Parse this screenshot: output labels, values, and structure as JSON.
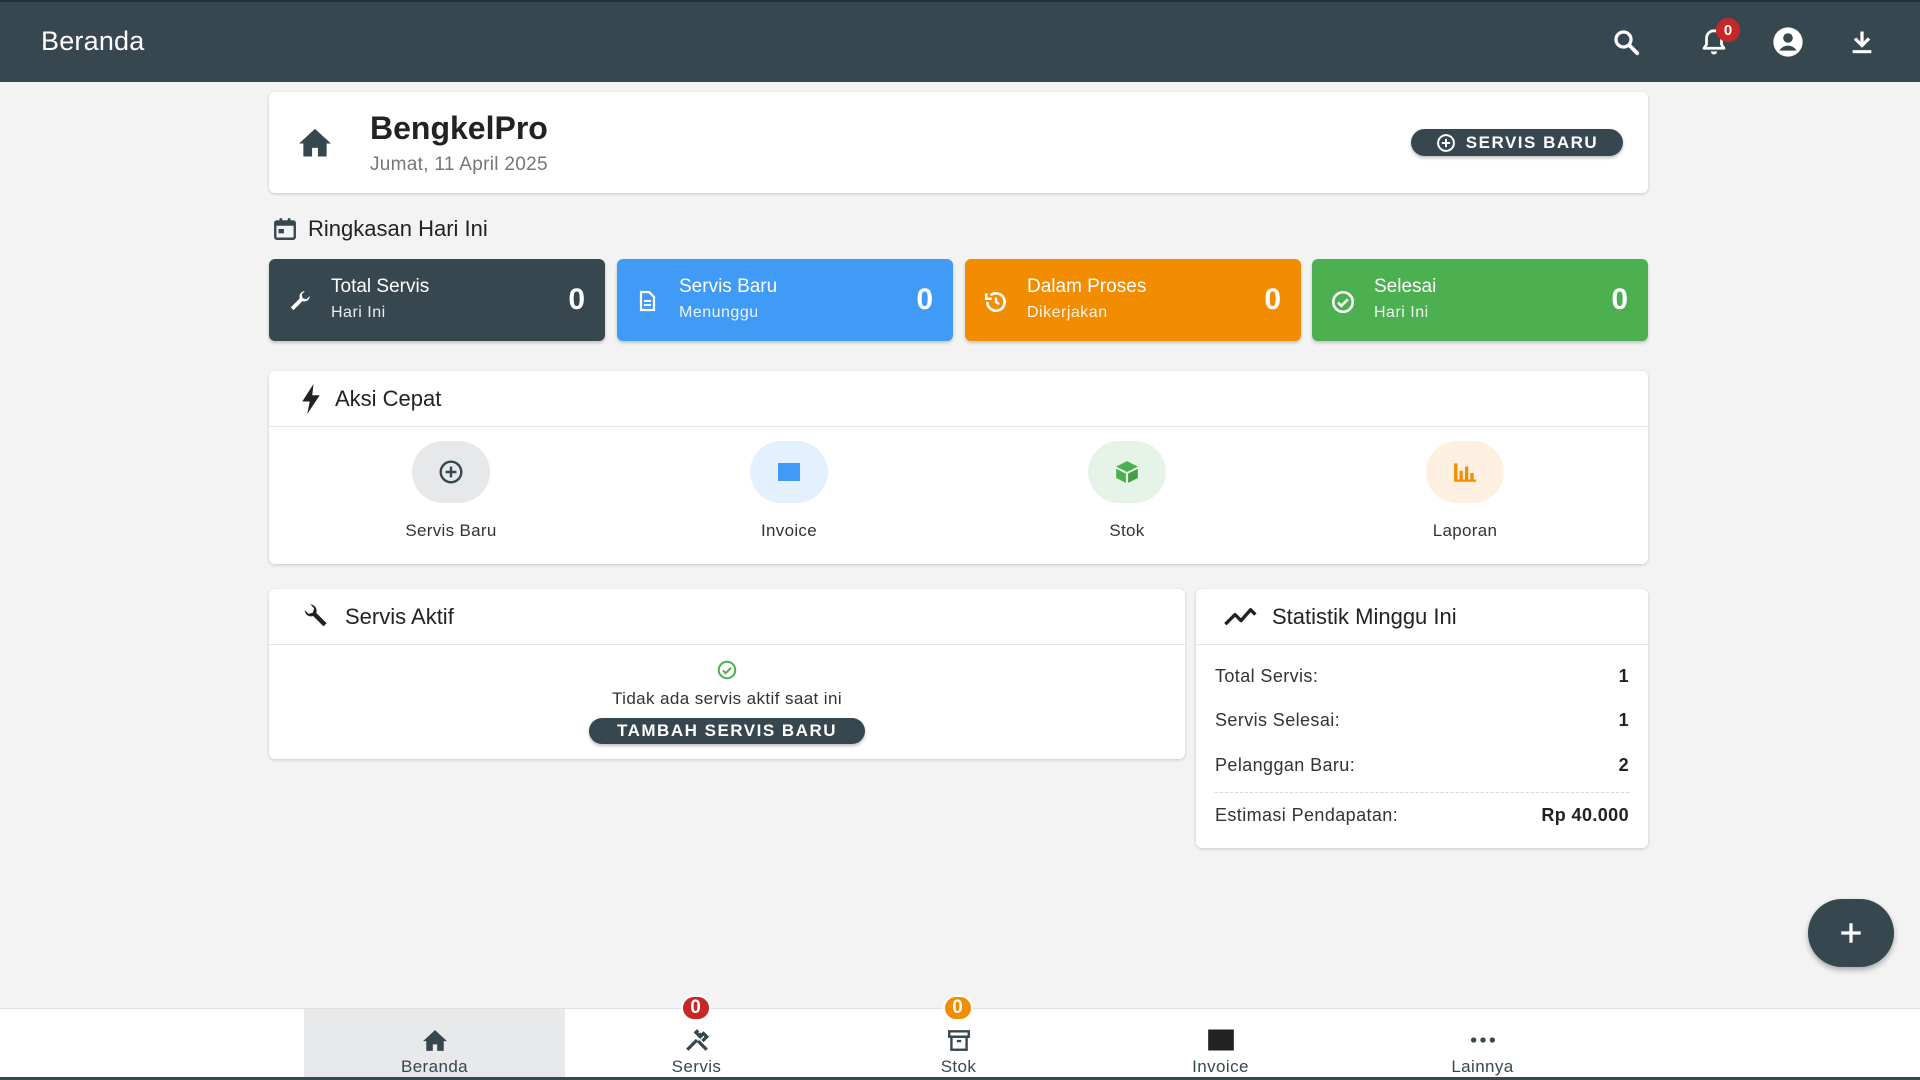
{
  "appbar": {
    "title": "Beranda",
    "icons": [
      "search-icon",
      "bell-icon",
      "account-icon",
      "download-icon"
    ],
    "notif_count": "0"
  },
  "header": {
    "brand": "BengkelPro",
    "date": "Jumat, 11 April 2025",
    "new_service_label": "SERVIS BARU"
  },
  "summary": {
    "title": "Ringkasan Hari Ini",
    "tiles": [
      {
        "label": "Total Servis",
        "sub": "Hari Ini",
        "value": "0",
        "color": "#37474f",
        "icon": "wrench-icon"
      },
      {
        "label": "Servis Baru",
        "sub": "Menunggu",
        "value": "0",
        "color": "#3f9bf5",
        "icon": "document-icon"
      },
      {
        "label": "Dalam Proses",
        "sub": "Dikerjakan",
        "value": "0",
        "color": "#f28c00",
        "icon": "progress-icon"
      },
      {
        "label": "Selesai",
        "sub": "Hari Ini",
        "value": "0",
        "color": "#4caf50",
        "icon": "check-circle-icon"
      }
    ]
  },
  "quick_actions": {
    "title": "Aksi Cepat",
    "items": [
      {
        "label": "Servis Baru",
        "bg": "#e6e8ea",
        "icon": "add-circle-icon"
      },
      {
        "label": "Invoice",
        "bg": "#e3f0fd",
        "icon": "invoice-icon"
      },
      {
        "label": "Stok",
        "bg": "#e6f4e7",
        "icon": "box-icon"
      },
      {
        "label": "Laporan",
        "bg": "#fdf0e1",
        "icon": "bar-chart-icon"
      }
    ]
  },
  "active_services": {
    "title": "Servis Aktif",
    "empty_text": "Tidak ada servis aktif saat ini",
    "add_label": "TAMBAH SERVIS BARU"
  },
  "weekly_stats": {
    "title": "Statistik Minggu Ini",
    "rows": [
      {
        "label": "Total Servis:",
        "value": "1"
      },
      {
        "label": "Servis Selesai:",
        "value": "1"
      },
      {
        "label": "Pelanggan Baru:",
        "value": "2"
      }
    ],
    "revenue": {
      "label": "Estimasi Pendapatan:",
      "value": "Rp 40.000"
    }
  },
  "bottom_nav": {
    "items": [
      {
        "label": "Beranda",
        "icon": "home-icon"
      },
      {
        "label": "Servis",
        "icon": "tools-icon",
        "badge": "0"
      },
      {
        "label": "Stok",
        "icon": "archive-icon",
        "badge": "0"
      },
      {
        "label": "Invoice",
        "icon": "invoice-icon"
      },
      {
        "label": "Lainnya",
        "icon": "more-icon"
      }
    ]
  },
  "colors": {
    "primary": "#37474f",
    "badge_red": "#c62828",
    "badge_orange": "#f28c00"
  }
}
